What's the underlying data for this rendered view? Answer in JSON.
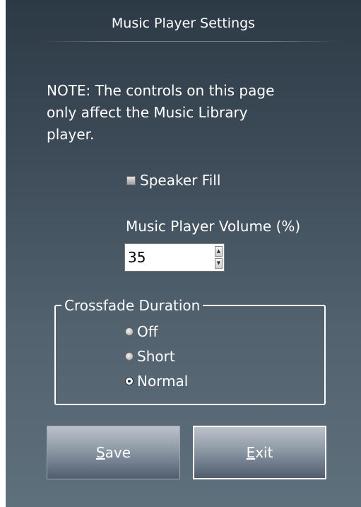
{
  "header": {
    "title": "Music Player Settings"
  },
  "note": {
    "line1": "NOTE: The controls on this page",
    "line2": "only affect the Music Library",
    "line3": "player."
  },
  "speaker_fill": {
    "label": "Speaker Fill",
    "checked": false
  },
  "volume": {
    "label": "Music Player Volume (%)",
    "value": "35"
  },
  "crossfade": {
    "legend": "Crossfade Duration",
    "options": [
      {
        "label": "Off",
        "selected": false
      },
      {
        "label": "Short",
        "selected": false
      },
      {
        "label": "Normal",
        "selected": true
      }
    ]
  },
  "buttons": {
    "save": {
      "mnemonic": "S",
      "rest": "ave"
    },
    "exit": {
      "mnemonic": "E",
      "rest": "xit"
    }
  }
}
